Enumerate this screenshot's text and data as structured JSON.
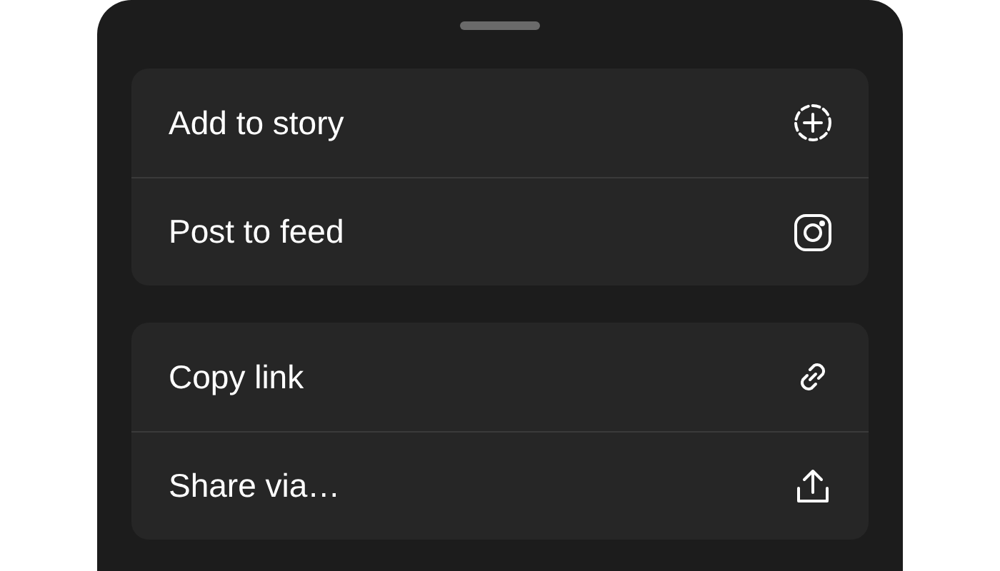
{
  "groups": [
    {
      "items": [
        {
          "label": "Add to story"
        },
        {
          "label": "Post to feed"
        }
      ]
    },
    {
      "items": [
        {
          "label": "Copy link"
        },
        {
          "label": "Share via…"
        }
      ]
    }
  ]
}
